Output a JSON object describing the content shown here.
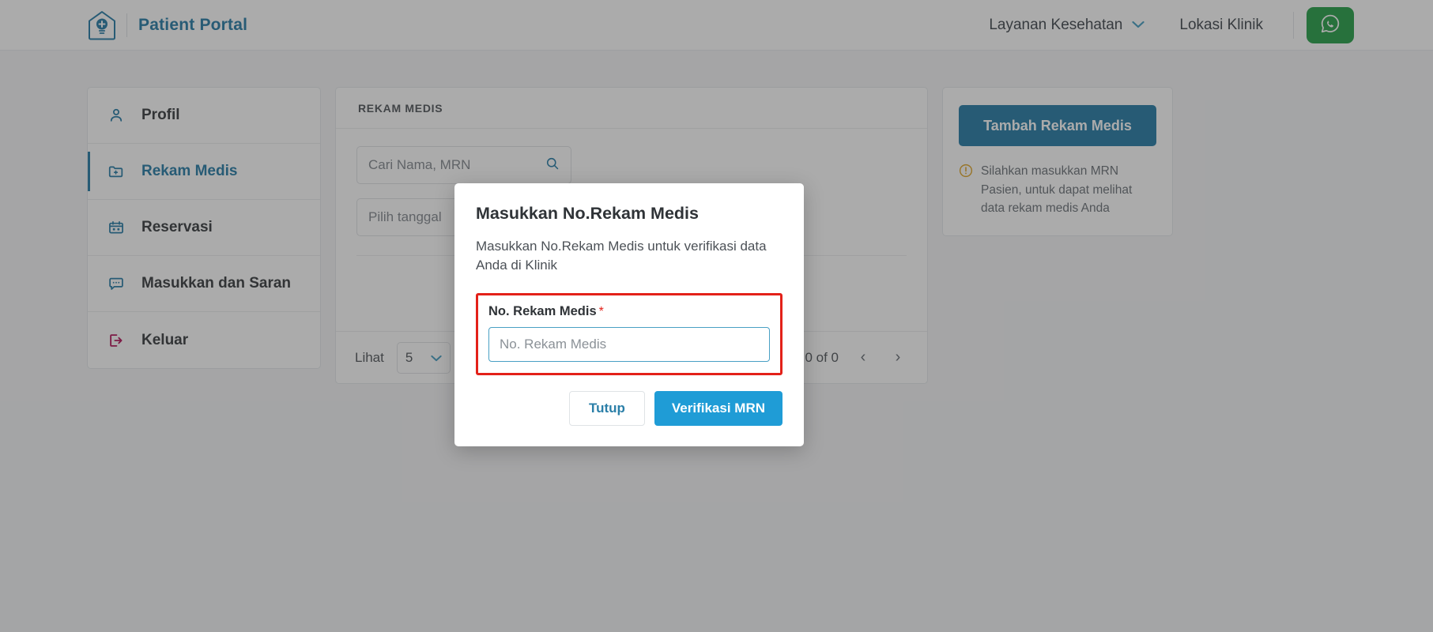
{
  "navbar": {
    "brand": "Patient Portal",
    "logo_icon": "clinic-house-bulb-logo",
    "links": [
      {
        "label": "Layanan Kesehatan",
        "has_chevron": true,
        "chevron_icon": "chevron-down-icon"
      },
      {
        "label": "Lokasi Klinik",
        "has_chevron": false
      }
    ],
    "whatsapp_icon": "whatsapp-icon",
    "whatsapp_color": "#2ba24c"
  },
  "sidebar": {
    "items": [
      {
        "label": "Profil",
        "icon": "user-icon",
        "active": false
      },
      {
        "label": "Rekam Medis",
        "icon": "folder-plus-icon",
        "active": true
      },
      {
        "label": "Reservasi",
        "icon": "calendar-icon",
        "active": false
      },
      {
        "label": "Masukkan dan Saran",
        "icon": "chat-bubble-icon",
        "active": false
      },
      {
        "label": "Keluar",
        "icon": "logout-icon",
        "active": false
      }
    ]
  },
  "main": {
    "card_title": "REKAM MEDIS",
    "search": {
      "placeholder": "Cari Nama, MRN",
      "value": "",
      "icon": "search-icon"
    },
    "date_filter": {
      "placeholder": "Pilih tanggal",
      "value": ""
    },
    "pagination": {
      "label": "Lihat",
      "page_size": "5",
      "page_size_chevron": "chevron-down-icon",
      "range": "0 - 0 of 0",
      "prev_icon": "chevron-left-icon",
      "next_icon": "chevron-right-icon",
      "prev_glyph": "‹",
      "next_glyph": "›"
    }
  },
  "right_panel": {
    "add_button": "Tambah Rekam Medis",
    "hint_icon": "alert-circle-icon",
    "hint_text": "Silahkan masukkan MRN Pasien, untuk dapat melihat data rekam medis Anda"
  },
  "modal": {
    "title": "Masukkan No.Rekam Medis",
    "description": "Masukkan No.Rekam Medis untuk verifikasi data Anda di Klinik",
    "field_label": "No. Rekam Medis",
    "required_mark": "*",
    "field_placeholder": "No. Rekam Medis",
    "field_value": "",
    "close_button": "Tutup",
    "submit_button": "Verifikasi MRN"
  },
  "colors": {
    "brand_teal": "#2b7fa8",
    "accent_blue": "#1f9cd6",
    "whatsapp_green": "#2ba24c",
    "highlight_red": "#e32119",
    "logout_crimson": "#b5185c",
    "warning_amber": "#e0a82e"
  }
}
